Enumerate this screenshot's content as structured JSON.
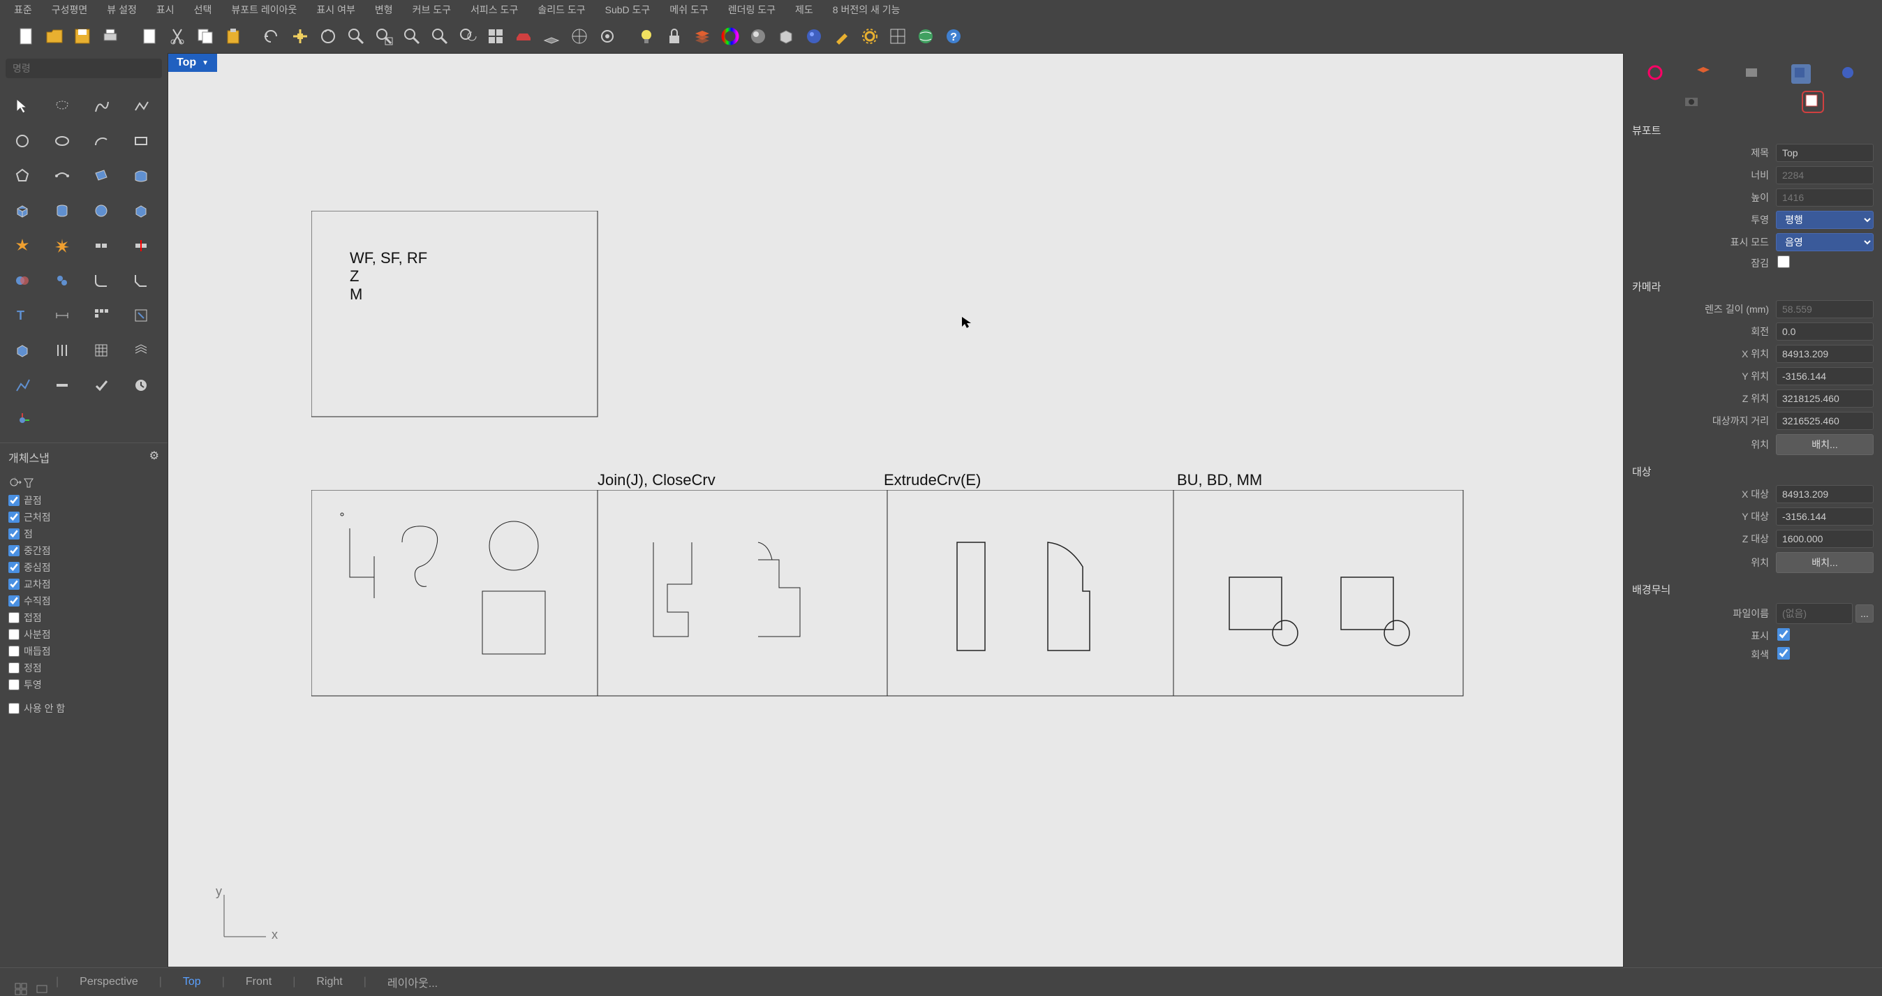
{
  "menubar": [
    "표준",
    "구성평면",
    "뷰 설정",
    "표시",
    "선택",
    "뷰포트 레이아웃",
    "표시 여부",
    "변형",
    "커브 도구",
    "서피스 도구",
    "솔리드 도구",
    "SubD 도구",
    "메쉬 도구",
    "렌더링 도구",
    "제도",
    "8 버전의 새 기능"
  ],
  "command_placeholder": "명령",
  "osnap": {
    "title": "개체스냅",
    "items": [
      {
        "label": "끝점",
        "checked": true
      },
      {
        "label": "근처점",
        "checked": true
      },
      {
        "label": "점",
        "checked": true
      },
      {
        "label": "중간점",
        "checked": true
      },
      {
        "label": "중심점",
        "checked": true
      },
      {
        "label": "교차점",
        "checked": true
      },
      {
        "label": "수직점",
        "checked": true
      },
      {
        "label": "접점",
        "checked": false
      },
      {
        "label": "사분점",
        "checked": false
      },
      {
        "label": "매듭점",
        "checked": false
      },
      {
        "label": "정점",
        "checked": false
      },
      {
        "label": "투영",
        "checked": false
      }
    ],
    "disable_all": "사용 안 함"
  },
  "viewport": {
    "label": "Top",
    "axis_x": "x",
    "axis_y": "y",
    "note_box": {
      "line1": "WF, SF, RF",
      "line2": "Z",
      "line3": "M"
    },
    "box_labels": {
      "b2": "Join(J), CloseCrv",
      "b3": "ExtrudeCrv(E)",
      "b4": "BU, BD, MM"
    }
  },
  "properties": {
    "section_viewport": "뷰포트",
    "title_label": "제목",
    "title_value": "Top",
    "width_label": "너비",
    "width_value": "2284",
    "height_label": "높이",
    "height_value": "1416",
    "projection_label": "투영",
    "projection_value": "평행",
    "display_mode_label": "표시 모드",
    "display_mode_value": "음영",
    "locked_label": "잠김",
    "section_camera": "카메라",
    "lens_label": "렌즈 길이 (mm)",
    "lens_value": "58.559",
    "rotation_label": "회전",
    "rotation_value": "0.0",
    "xpos_label": "X 위치",
    "xpos_value": "84913.209",
    "ypos_label": "Y 위치",
    "ypos_value": "-3156.144",
    "zpos_label": "Z 위치",
    "zpos_value": "3218125.460",
    "dist_label": "대상까지 거리",
    "dist_value": "3216525.460",
    "position_label": "위치",
    "position_btn": "배치...",
    "section_target": "대상",
    "xt_label": "X 대상",
    "xt_value": "84913.209",
    "yt_label": "Y 대상",
    "yt_value": "-3156.144",
    "zt_label": "Z 대상",
    "zt_value": "1600.000",
    "tpos_label": "위치",
    "tpos_btn": "배치...",
    "section_wallpaper": "배경무늬",
    "file_label": "파일이름",
    "file_value": "(없음)",
    "show_label": "표시",
    "gray_label": "회색"
  },
  "statusbar": {
    "perspective": "Perspective",
    "top": "Top",
    "front": "Front",
    "right": "Right",
    "layout": "레이아웃..."
  }
}
